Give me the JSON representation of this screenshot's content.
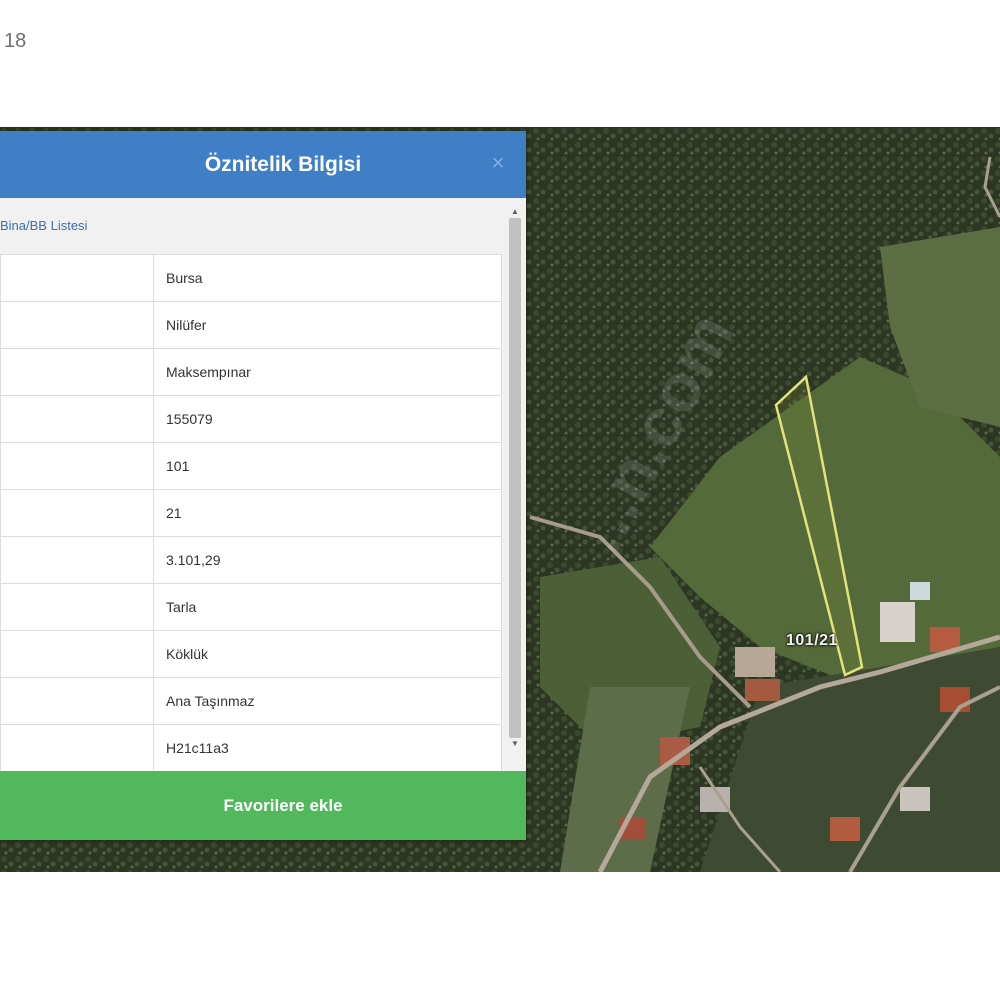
{
  "page_number": "18",
  "modal": {
    "title": "Öznitelik Bilgisi",
    "close_icon": "×",
    "list_link": "Bina/BB Listesi",
    "rows": [
      {
        "value": "Bursa"
      },
      {
        "value": "Nilüfer"
      },
      {
        "value": "Maksempınar"
      },
      {
        "value": "155079"
      },
      {
        "value": "101"
      },
      {
        "value": "21"
      },
      {
        "value": "3.101,29"
      },
      {
        "value": "Tarla"
      },
      {
        "value": "Köklük"
      },
      {
        "value": "Ana Taşınmaz"
      },
      {
        "value": "H21c11a3"
      }
    ],
    "favorite_button": "Favorilere ekle"
  },
  "map": {
    "parcel_label": "101/21",
    "watermark": "...n.com",
    "parcel_outline_color": "#e3e37a"
  }
}
